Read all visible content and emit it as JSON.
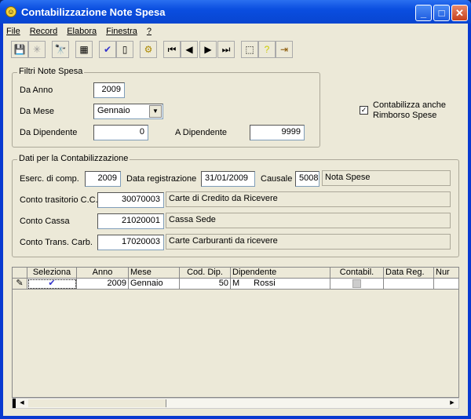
{
  "window": {
    "title": "Contabilizzazione Note Spesa"
  },
  "menu": [
    "File",
    "Record",
    "Elabora",
    "Finestra",
    "?"
  ],
  "toolbar": [
    "save-icon",
    "cancel-icon",
    "find-icon",
    "grid-icon",
    "select-all-icon",
    "deselect-icon",
    "process-icon",
    "first-record-icon",
    "prev-record-icon",
    "next-record-icon",
    "last-record-icon",
    "new-icon",
    "help-icon",
    "exit-icon"
  ],
  "filters": {
    "title": "Filtri Note Spesa",
    "da_anno_label": "Da Anno",
    "da_anno": "2009",
    "da_mese_label": "Da Mese",
    "da_mese": "Gennaio",
    "da_dip_label": "Da Dipendente",
    "da_dip": "0",
    "a_dip_label": "A Dipendente",
    "a_dip": "9999"
  },
  "rimborso": {
    "label1": "Contabilizza anche",
    "label2": "Rimborso Spese",
    "checked": true
  },
  "dati": {
    "title": "Dati per la Contabilizzazione",
    "eserc_label": "Eserc. di comp.",
    "eserc": "2009",
    "data_reg_label": "Data registrazione",
    "data_reg": "31/01/2009",
    "causale_label": "Causale",
    "causale": "5008",
    "causale_desc": "Nota Spese",
    "conti": [
      {
        "label": "Conto trasitorio C.C.",
        "code": "30070003",
        "desc": "Carte di Credito da Ricevere"
      },
      {
        "label": "Conto Cassa",
        "code": "21020001",
        "desc": "Cassa Sede"
      },
      {
        "label": "Conto Trans. Carb.",
        "code": "17020003",
        "desc": "Carte Carburanti da ricevere"
      }
    ]
  },
  "grid": {
    "headers": [
      "Seleziona",
      "Anno",
      "Mese",
      "Cod. Dip.",
      "Dipendente",
      "Contabil.",
      "Data Reg.",
      "Nur"
    ],
    "rows": [
      {
        "seleziona": true,
        "anno": "2009",
        "mese": "Gennaio",
        "cod": "50",
        "dip1": "M",
        "dip2": "Rossi",
        "contabil": false,
        "data": "",
        "num": ""
      }
    ]
  }
}
